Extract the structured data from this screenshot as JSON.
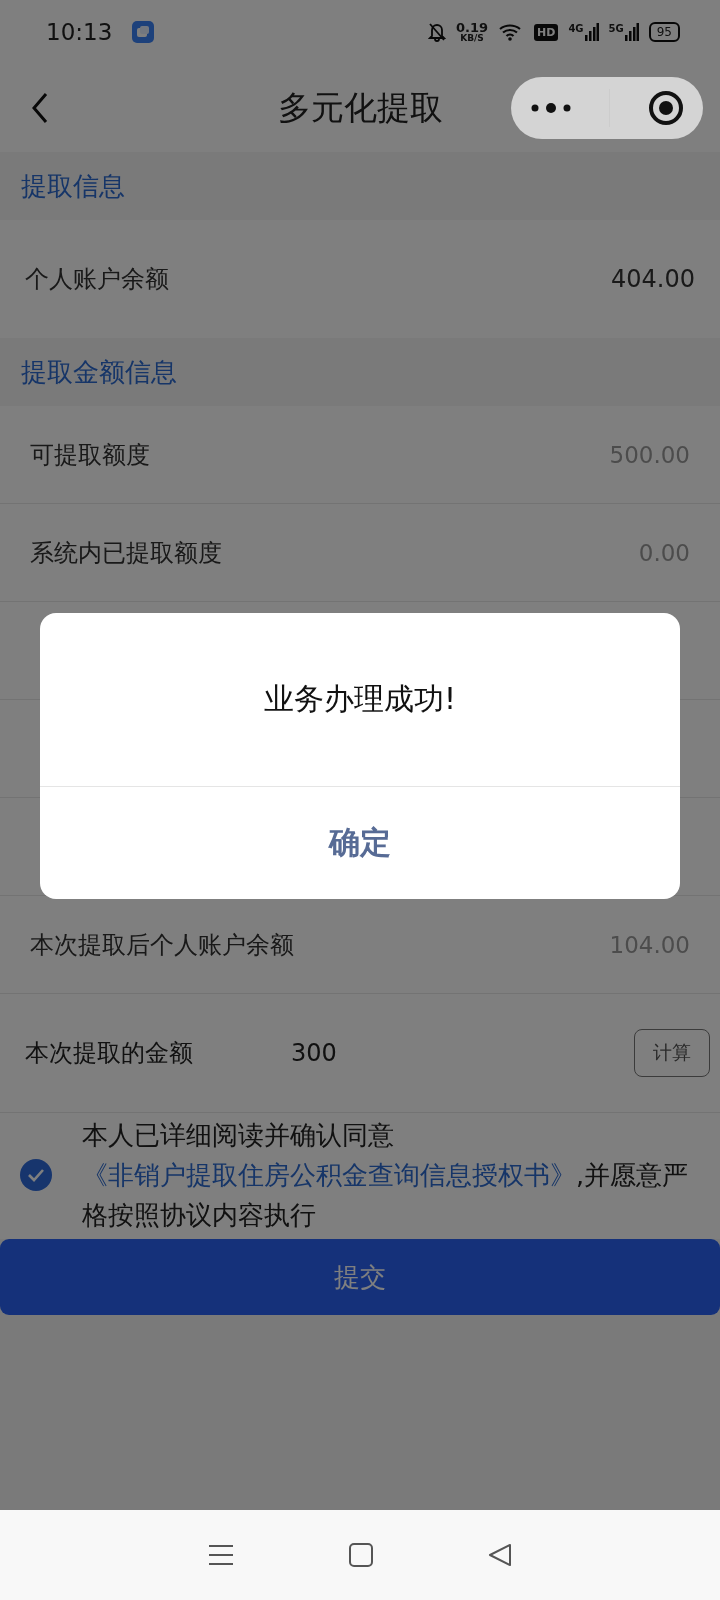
{
  "status_bar": {
    "time": "10:13",
    "speed_value": "0.19",
    "speed_unit": "KB/S",
    "hd": "HD",
    "sim_1": "4G",
    "sim_2": "5G",
    "battery": "95"
  },
  "nav": {
    "title": "多元化提取"
  },
  "sections": [
    {
      "title": "提取信息",
      "rows": [
        {
          "label": "个人账户余额",
          "value": "404.00"
        }
      ]
    },
    {
      "title": "提取金额信息",
      "rows": [
        {
          "label": "可提取额度",
          "value": "500.00"
        },
        {
          "label": "系统内已提取额度",
          "value": "0.00"
        }
      ]
    }
  ],
  "after_row": {
    "label": "本次提取后个人账户余额",
    "value": "104.00"
  },
  "amount": {
    "label": "本次提取的金额",
    "value": "300",
    "button": "计算"
  },
  "agreement": {
    "checked": true,
    "prefix": "本人已详细阅读并确认同意",
    "link": "《非销户提取住房公积金查询信息授权书》",
    "suffix": ",并愿意严格按照协议内容执行"
  },
  "submit": "提交",
  "dialog": {
    "message": "业务办理成功!",
    "confirm": "确定"
  }
}
